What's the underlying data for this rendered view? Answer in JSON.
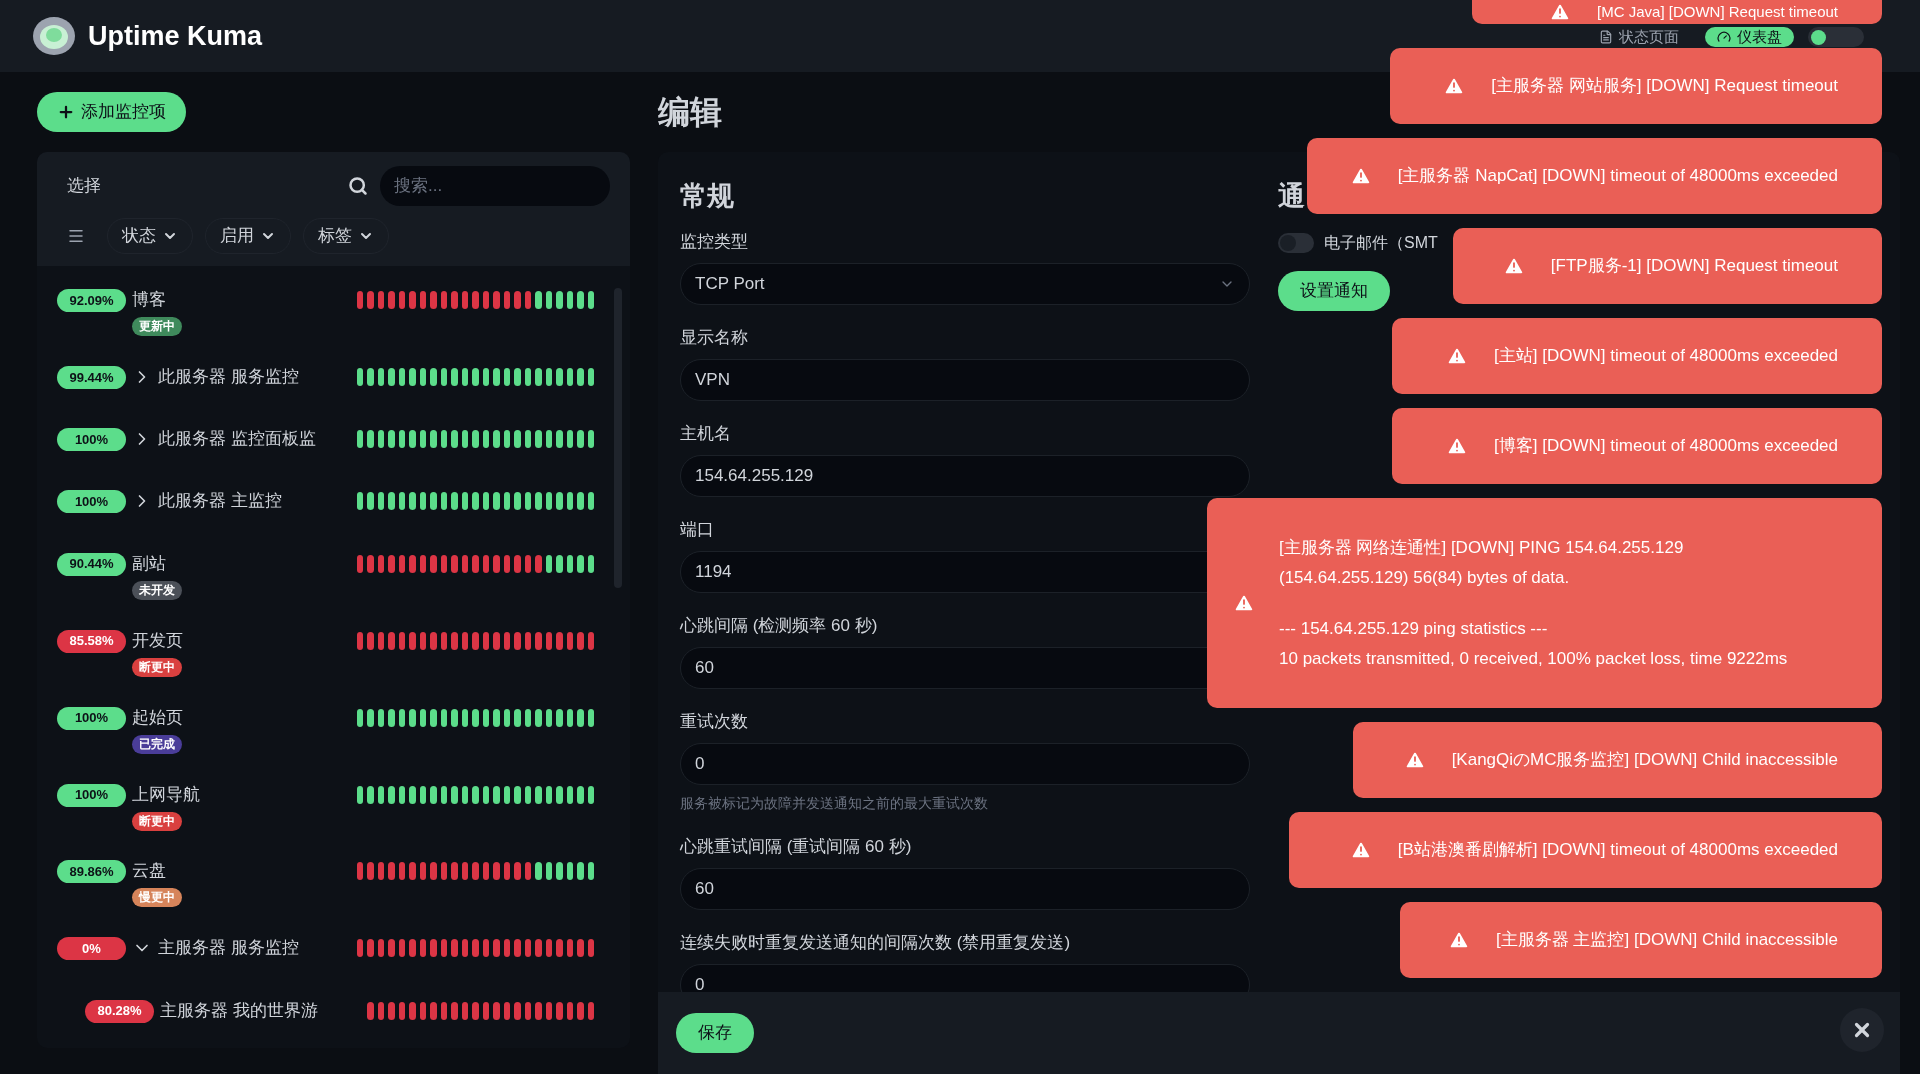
{
  "app": {
    "title": "Uptime Kuma"
  },
  "header_nav": [
    {
      "kind": "link",
      "label": "状态页面",
      "selected": false
    },
    {
      "kind": "link",
      "label": "仪表盘",
      "selected": true
    }
  ],
  "add_button": {
    "label": "添加监控项"
  },
  "sidebar": {
    "select_button": "选择",
    "search": {
      "placeholder": "搜索..."
    },
    "filters": [
      {
        "label": "状态"
      },
      {
        "label": "启用"
      },
      {
        "label": "标签"
      }
    ],
    "monitors": [
      {
        "uptime": "92.09%",
        "up": true,
        "name": "博客",
        "tag": {
          "label": "更新中",
          "color": "#3f8a5c"
        },
        "beats": [
          false,
          false,
          false,
          false,
          false,
          false,
          false,
          false,
          false,
          false,
          false,
          false,
          false,
          false,
          false,
          false,
          false,
          true,
          true,
          true,
          true,
          true,
          true
        ]
      },
      {
        "uptime": "99.44%",
        "up": true,
        "name": "此服务器 服务监控",
        "expanded": false,
        "beats": [
          true,
          true,
          true,
          true,
          true,
          true,
          true,
          true,
          true,
          true,
          true,
          true,
          true,
          true,
          true,
          true,
          true,
          true,
          true,
          true,
          true,
          true,
          true
        ]
      },
      {
        "uptime": "100%",
        "up": true,
        "name": "此服务器 监控面板监",
        "expanded": false,
        "beats": [
          true,
          true,
          true,
          true,
          true,
          true,
          true,
          true,
          true,
          true,
          true,
          true,
          true,
          true,
          true,
          true,
          true,
          true,
          true,
          true,
          true,
          true,
          true
        ]
      },
      {
        "uptime": "100%",
        "up": true,
        "name": "此服务器 主监控",
        "expanded": false,
        "beats": [
          true,
          true,
          true,
          true,
          true,
          true,
          true,
          true,
          true,
          true,
          true,
          true,
          true,
          true,
          true,
          true,
          true,
          true,
          true,
          true,
          true,
          true,
          true
        ]
      },
      {
        "uptime": "90.44%",
        "up": true,
        "name": "副站",
        "tag": {
          "label": "未开发",
          "color": "#4b5058"
        },
        "beats": [
          false,
          false,
          false,
          false,
          false,
          false,
          false,
          false,
          false,
          false,
          false,
          false,
          false,
          false,
          false,
          false,
          false,
          false,
          true,
          true,
          true,
          true,
          true
        ]
      },
      {
        "uptime": "85.58%",
        "up": false,
        "name": "开发页",
        "tag": {
          "label": "断更中",
          "color": "#d9403f"
        },
        "beats": [
          false,
          false,
          false,
          false,
          false,
          false,
          false,
          false,
          false,
          false,
          false,
          false,
          false,
          false,
          false,
          false,
          false,
          false,
          false,
          false,
          false,
          false,
          false
        ]
      },
      {
        "uptime": "100%",
        "up": true,
        "name": "起始页",
        "tag": {
          "label": "已完成",
          "color": "#4a3d99"
        },
        "beats": [
          true,
          true,
          true,
          true,
          true,
          true,
          true,
          true,
          true,
          true,
          true,
          true,
          true,
          true,
          true,
          true,
          true,
          true,
          true,
          true,
          true,
          true,
          true
        ]
      },
      {
        "uptime": "100%",
        "up": true,
        "name": "上网导航",
        "tag": {
          "label": "断更中",
          "color": "#d9403f"
        },
        "beats": [
          true,
          true,
          true,
          true,
          true,
          true,
          true,
          true,
          true,
          true,
          true,
          true,
          true,
          true,
          true,
          true,
          true,
          true,
          true,
          true,
          true,
          true,
          true
        ]
      },
      {
        "uptime": "89.86%",
        "up": true,
        "name": "云盘",
        "tag": {
          "label": "慢更中",
          "color": "#d6845a"
        },
        "beats": [
          false,
          false,
          false,
          false,
          false,
          false,
          false,
          false,
          false,
          false,
          false,
          false,
          false,
          false,
          false,
          false,
          false,
          true,
          true,
          true,
          true,
          true,
          true
        ]
      },
      {
        "uptime": "0%",
        "up": false,
        "name": "主服务器 服务监控",
        "expanded": true,
        "beats": [
          false,
          false,
          false,
          false,
          false,
          false,
          false,
          false,
          false,
          false,
          false,
          false,
          false,
          false,
          false,
          false,
          false,
          false,
          false,
          false,
          false,
          false,
          false
        ],
        "children": [
          {
            "uptime": "80.28%",
            "up": false,
            "name": "主服务器 我的世界游",
            "beats": [
              false,
              false,
              false,
              false,
              false,
              false,
              false,
              false,
              false,
              false,
              false,
              false,
              false,
              false,
              false,
              false,
              false,
              false,
              false,
              false,
              false,
              false
            ]
          }
        ]
      }
    ]
  },
  "page_title": "编辑",
  "general": {
    "heading": "常规",
    "fields": [
      {
        "kind": "select",
        "label": "监控类型",
        "value": "TCP Port"
      },
      {
        "kind": "input",
        "label": "显示名称",
        "value": "VPN"
      },
      {
        "kind": "input",
        "label": "主机名",
        "value": "154.64.255.129"
      },
      {
        "kind": "input",
        "label": "端口",
        "value": "1194"
      },
      {
        "kind": "input",
        "label": "心跳间隔 (检测频率 60 秒)",
        "value": "60"
      },
      {
        "kind": "input",
        "label": "重试次数",
        "value": "0",
        "help": "服务被标记为故障并发送通知之前的最大重试次数"
      },
      {
        "kind": "input",
        "label": "心跳重试间隔 (重试间隔 60 秒)",
        "value": "60"
      },
      {
        "kind": "input",
        "label": "连续失败时重复发送通知的间隔次数 (禁用重复发送)",
        "value": "0"
      }
    ]
  },
  "notifications": {
    "heading": "通",
    "items": [
      {
        "label": "电子邮件（SMT",
        "on": false
      }
    ],
    "setup_button": "设置通知"
  },
  "save_button": "保存",
  "toasts": [
    {
      "kind": "single",
      "text": "[MC Java] [DOWN] Request timeout"
    },
    {
      "kind": "single",
      "text": "[主服务器 网站服务] [DOWN] Request timeout"
    },
    {
      "kind": "single",
      "text": "[主服务器 NapCat] [DOWN] timeout of 48000ms exceeded"
    },
    {
      "kind": "single",
      "text": "[FTP服务-1] [DOWN] Request timeout"
    },
    {
      "kind": "single",
      "text": "[主站] [DOWN] timeout of 48000ms exceeded"
    },
    {
      "kind": "single",
      "text": "[博客] [DOWN] timeout of 48000ms exceeded"
    },
    {
      "kind": "multi",
      "paragraphs": [
        [
          "[主服务器 网络连通性] [DOWN] PING 154.64.255.129",
          "(154.64.255.129) 56(84) bytes of data."
        ],
        [
          "--- 154.64.255.129 ping statistics ---",
          "10 packets transmitted, 0 received, 100% packet loss, time 9222ms"
        ]
      ]
    },
    {
      "kind": "single",
      "text": "[KangQiのMC服务监控] [DOWN] Child inaccessible"
    },
    {
      "kind": "single",
      "text": "[B站港澳番剧解析] [DOWN] timeout of 48000ms exceeded"
    },
    {
      "kind": "single",
      "text": "[主服务器 主监控] [DOWN] Child inaccessible"
    }
  ]
}
